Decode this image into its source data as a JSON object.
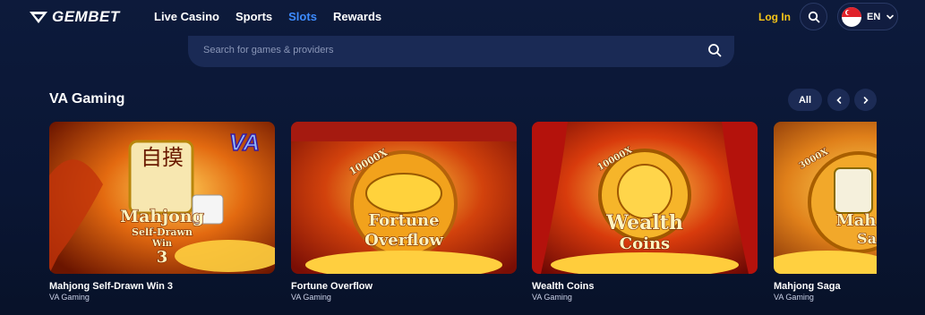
{
  "header": {
    "logo_text": "GEMBET",
    "nav": [
      {
        "label": "Live Casino",
        "active": false
      },
      {
        "label": "Sports",
        "active": false
      },
      {
        "label": "Slots",
        "active": true
      },
      {
        "label": "Rewards",
        "active": false
      }
    ],
    "login_label": "Log In",
    "language": "EN"
  },
  "search": {
    "placeholder": "Search for games & providers"
  },
  "section": {
    "title": "VA Gaming",
    "all_label": "All"
  },
  "games": [
    {
      "title": "Mahjong Self-Drawn Win 3",
      "provider": "VA Gaming",
      "art_lines": [
        "Mahjong",
        "Self-Drawn",
        "Win",
        "3"
      ],
      "badge": "VA"
    },
    {
      "title": "Fortune Overflow",
      "provider": "VA Gaming",
      "art_lines": [
        "Fortune",
        "Overflow"
      ],
      "badge": "10000X"
    },
    {
      "title": "Wealth Coins",
      "provider": "VA Gaming",
      "art_lines": [
        "Wealth",
        "Coins"
      ],
      "badge": "10000X"
    },
    {
      "title": "Mahjong Saga",
      "provider": "VA Gaming",
      "art_lines": [
        "Mah",
        "Sa"
      ],
      "badge": "3000X"
    }
  ],
  "colors": {
    "accent_active": "#3d8cff",
    "login": "#f5c518",
    "background": "#0a1634"
  },
  "icons": [
    "logo-mark-icon",
    "search-icon",
    "chevron-down-icon",
    "chevron-left-icon",
    "chevron-right-icon",
    "singapore-flag-icon"
  ]
}
